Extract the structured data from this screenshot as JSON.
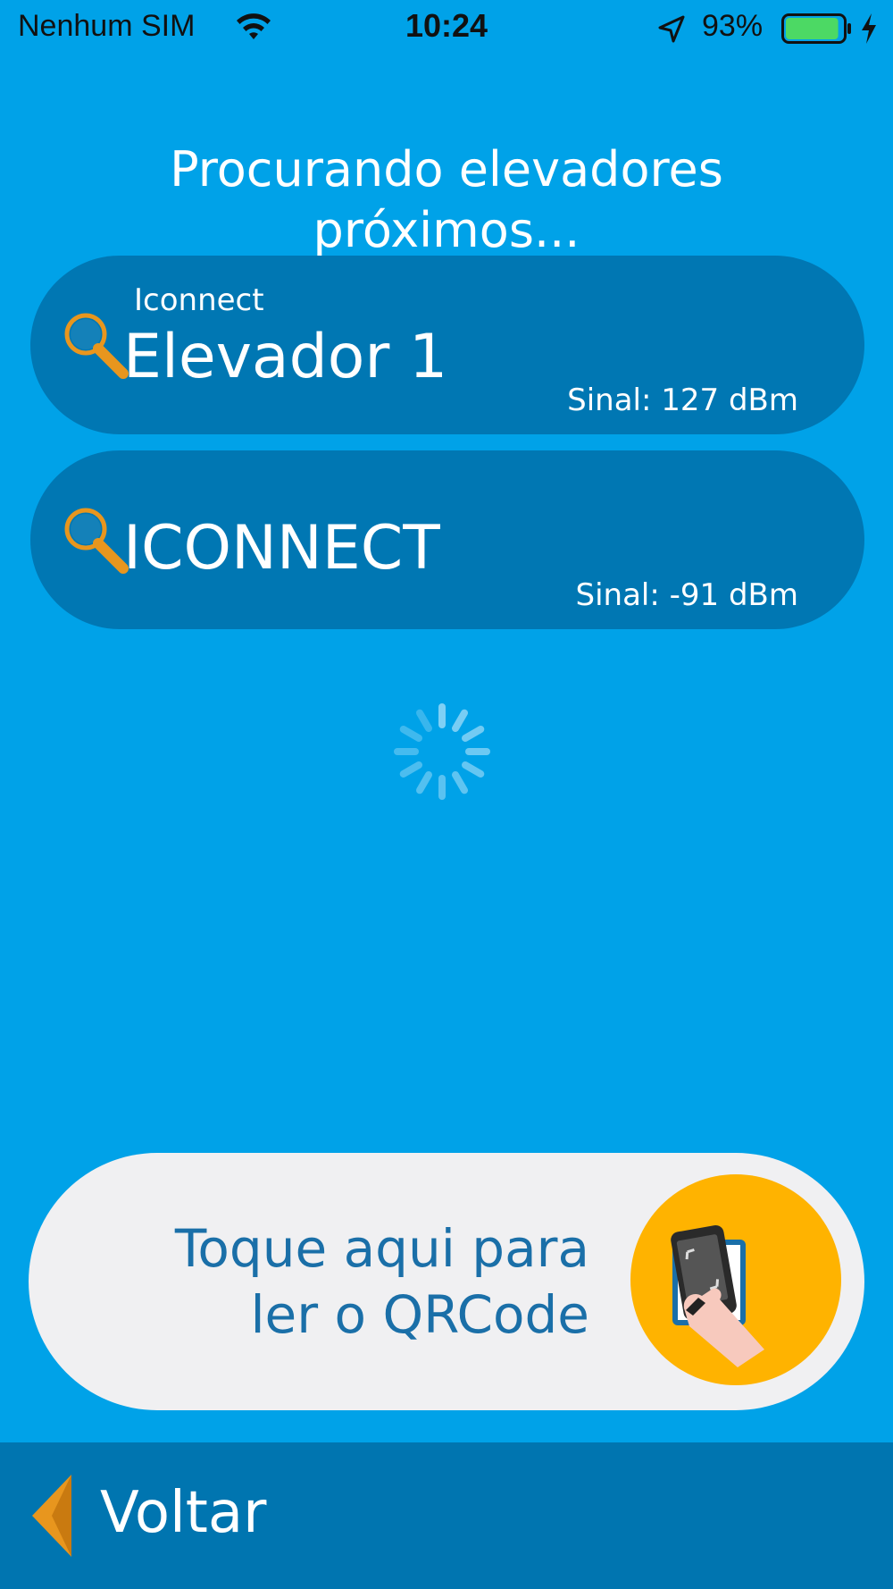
{
  "status_bar": {
    "carrier": "Nenhum SIM",
    "time": "10:24",
    "battery_percent": "93%",
    "battery_level": 0.93,
    "icons": [
      "wifi-icon",
      "location-arrow-icon",
      "battery-icon",
      "charging-bolt-icon"
    ]
  },
  "heading": {
    "line1": "Procurando elevadores",
    "line2": "próximos..."
  },
  "devices": [
    {
      "subtitle": "Iconnect",
      "name": "Elevador 1",
      "signal": "Sinal: 127 dBm",
      "icon": "search-icon"
    },
    {
      "subtitle": "",
      "name": "ICONNECT",
      "signal": "Sinal: -91 dBm",
      "icon": "search-icon"
    }
  ],
  "qr_button": {
    "line1": "Toque aqui para",
    "line2": "ler o QRCode",
    "icon": "phone-qrcode-scan-icon"
  },
  "bottom_bar": {
    "back_label": "Voltar",
    "icon": "back-arrow-icon"
  },
  "colors": {
    "background": "#00a2e8",
    "card": "#0077b3",
    "accent": "#ffb300",
    "qr_text": "#1a6fa8",
    "bottom_bar": "#0075b0"
  }
}
